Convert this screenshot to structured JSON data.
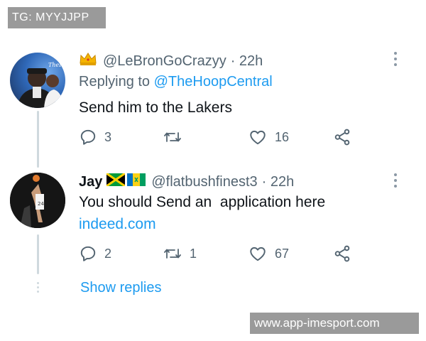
{
  "watermark": {
    "top_left": "TG: MYYJJPP",
    "bottom_right": "www.app-imesport.com"
  },
  "tweets": [
    {
      "display_name": "",
      "handle": "@LeBronGoCrazyy",
      "time": "· 22h",
      "replying_prefix": "Replying to ",
      "replying_to": "@TheHoopCentral",
      "text": "Send him to the Lakers",
      "link": "",
      "replies": "3",
      "retweets": "",
      "likes": "16"
    },
    {
      "display_name": "Jay",
      "handle": "@flatbushfinest3",
      "time": "· 22h",
      "text": "You should Send an  application here",
      "link": "indeed.com",
      "replies": "2",
      "retweets": "1",
      "likes": "67"
    }
  ],
  "show_replies": "Show replies",
  "icons": [
    "crown-icon",
    "jamaica-flag-icon",
    "svg-flag-icon",
    "more-icon",
    "reply-icon",
    "retweet-icon",
    "like-icon",
    "share-icon"
  ],
  "colors": {
    "link": "#1d9bf0",
    "muted": "#536471",
    "text": "#0f1419"
  }
}
